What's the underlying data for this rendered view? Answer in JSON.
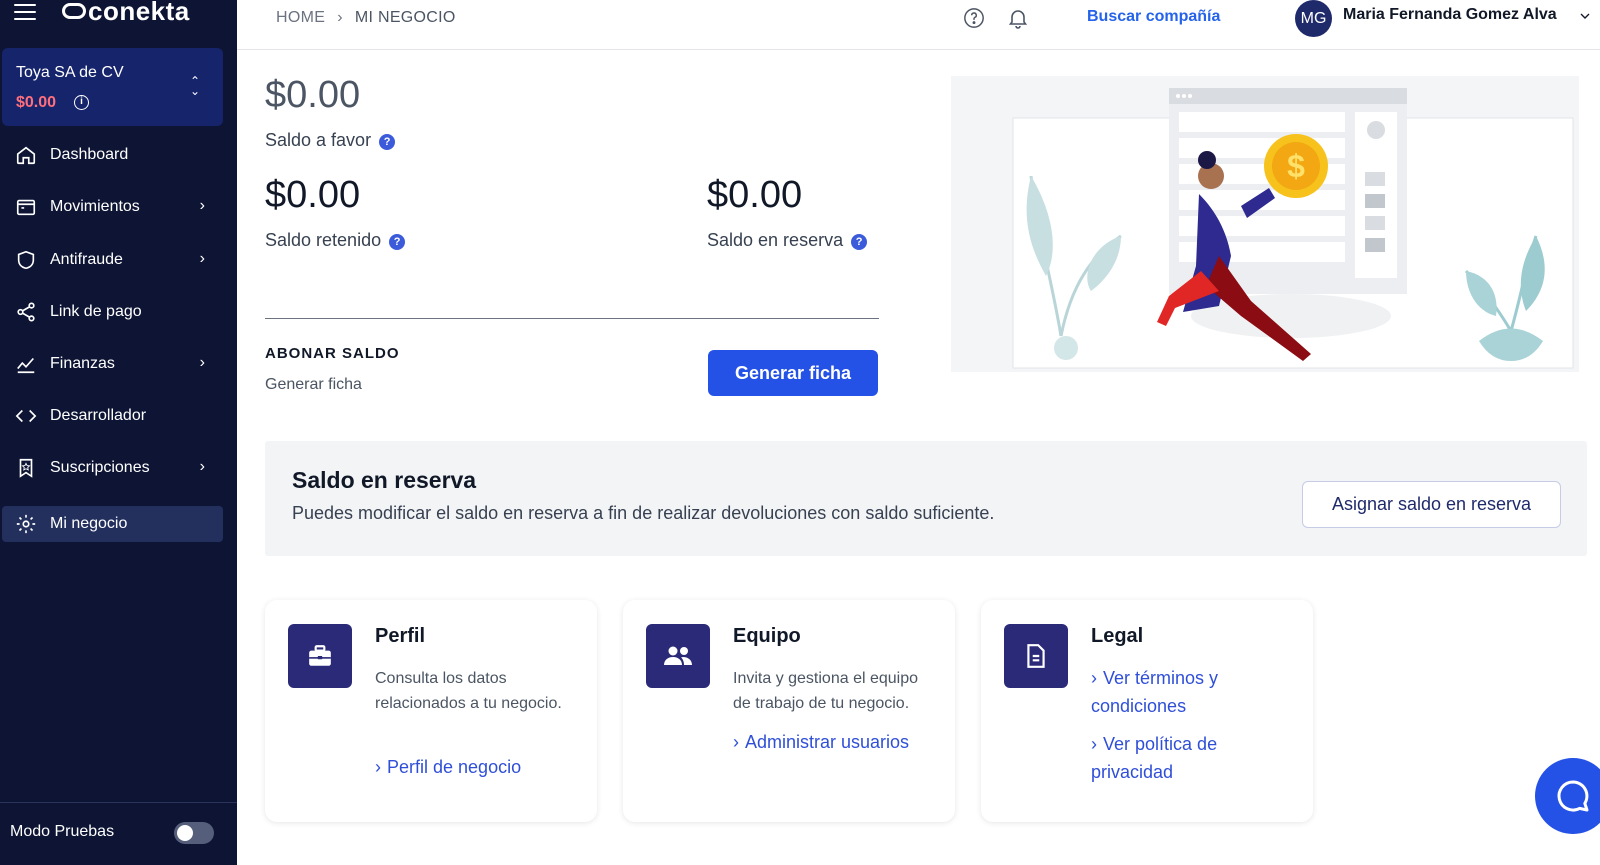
{
  "sidebar": {
    "logo": "conekta",
    "company": {
      "name": "Toya SA de CV",
      "balance": "$0.00"
    },
    "nav": [
      {
        "label": "Dashboard"
      },
      {
        "label": "Movimientos"
      },
      {
        "label": "Antifraude"
      },
      {
        "label": "Link de pago"
      },
      {
        "label": "Finanzas"
      },
      {
        "label": "Desarrollador"
      },
      {
        "label": "Suscripciones"
      },
      {
        "label": "Mi negocio"
      }
    ],
    "test_mode_label": "Modo Pruebas",
    "test_mode_on": false
  },
  "header": {
    "breadcrumb": [
      "HOME",
      "MI NEGOCIO"
    ],
    "search_company": "Buscar compañía",
    "user_initials": "MG",
    "user_name": "Maria Fernanda Gomez Alva"
  },
  "balances": {
    "favor": {
      "amount": "$0.00",
      "label": "Saldo a favor"
    },
    "retenido": {
      "amount": "$0.00",
      "label": "Saldo retenido"
    },
    "reserva": {
      "amount": "$0.00",
      "label": "Saldo en reserva"
    }
  },
  "abonar": {
    "title": "ABONAR SALDO",
    "subtitle": "Generar ficha",
    "button": "Generar ficha"
  },
  "reserve_panel": {
    "title": "Saldo en reserva",
    "description": "Puedes modificar el saldo en reserva a fin de realizar devoluciones con saldo suficiente.",
    "button": "Asignar saldo en reserva"
  },
  "cards": [
    {
      "title": "Perfil",
      "description": "Consulta los datos relacionados a tu negocio.",
      "links": [
        "Perfil de negocio"
      ]
    },
    {
      "title": "Equipo",
      "description": "Invita y gestiona el equipo de trabajo de tu negocio.",
      "links": [
        "Administrar usuarios"
      ]
    },
    {
      "title": "Legal",
      "description": "",
      "links": [
        "Ver términos y condiciones",
        "Ver política de privacidad"
      ]
    }
  ],
  "colors": {
    "sidebar": "#0e1534",
    "primary": "#2451e6",
    "card_icon": "#2b2a78",
    "balance_red": "#ff6f7c"
  }
}
